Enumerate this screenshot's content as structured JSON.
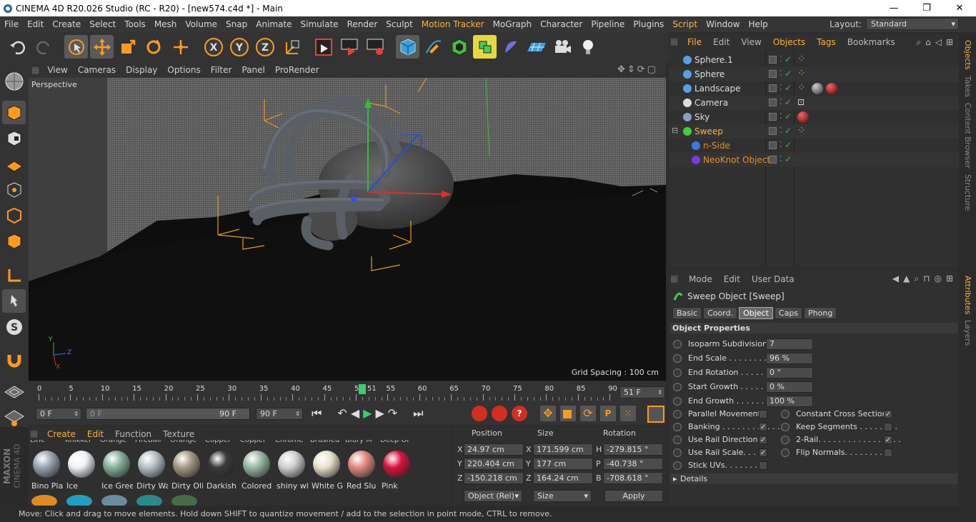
{
  "window": {
    "title": "CINEMA 4D R20.026 Studio (RC - R20) - [new574.c4d *] - Main"
  },
  "menu": [
    "File",
    "Edit",
    "Create",
    "Select",
    "Tools",
    "Mesh",
    "Volume",
    "Snap",
    "Animate",
    "Simulate",
    "Render",
    "Sculpt",
    "Motion Tracker",
    "MoGraph",
    "Character",
    "Pipeline",
    "Plugins",
    "Script",
    "Window",
    "Help"
  ],
  "layout": {
    "label": "Layout:",
    "value": "Standard"
  },
  "viewport": {
    "menu": [
      "View",
      "Cameras",
      "Display",
      "Options",
      "Filter",
      "Panel",
      "ProRender"
    ],
    "camera_label": "Perspective",
    "grid_spacing": "Grid Spacing : 100 cm",
    "axes": {
      "y": "Y",
      "z": "Z",
      "x": "X"
    }
  },
  "timeline": {
    "ticks": [
      "0",
      "5",
      "10",
      "15",
      "20",
      "25",
      "30",
      "35",
      "40",
      "45",
      "50",
      "55",
      "60",
      "65",
      "70",
      "75",
      "80",
      "85",
      "90"
    ],
    "current_marker": "51",
    "current_frame": "51 F"
  },
  "transport": {
    "start": "0 F",
    "range_start": "0 F",
    "range_end": "90 F",
    "end": "90 F"
  },
  "materials": {
    "menu": [
      "Create",
      "Edit",
      "Function",
      "Texture"
    ],
    "top_row_clipped": [
      "Line",
      "Knikker",
      "Orange",
      "FireBall",
      "Orange",
      "Copper",
      "Copper",
      "Chrome",
      "Brushed",
      "Blury M",
      "Deep Or"
    ],
    "items": [
      {
        "name": "Bino Pla",
        "color": "#9aa4b4"
      },
      {
        "name": "Ice",
        "color": "#eef3f6"
      },
      {
        "name": "Ice Gree",
        "color": "#86b09a"
      },
      {
        "name": "Dirty Wa",
        "color": "#b6c0c6"
      },
      {
        "name": "Dirty Oli",
        "color": "#a59a84"
      },
      {
        "name": "Darkish",
        "color": "#3a3a3a"
      },
      {
        "name": "Colored",
        "color": "#9ab6a4"
      },
      {
        "name": "shiny wl",
        "color": "#cfcfcf"
      },
      {
        "name": "White G",
        "color": "#e9e2cc"
      },
      {
        "name": "Red Slu",
        "color": "#e08a82"
      },
      {
        "name": "Pink",
        "color": "#d8143c"
      }
    ]
  },
  "coordinates": {
    "headers": {
      "position": "Position",
      "size": "Size",
      "rotation": "Rotation"
    },
    "rows": [
      {
        "axis": "X",
        "pos": "24.97 cm",
        "size_axis": "X",
        "size": "171.599 cm",
        "rot_axis": "H",
        "rot": "-279.815 °"
      },
      {
        "axis": "Y",
        "pos": "220.404 cm",
        "size_axis": "Y",
        "size": "177 cm",
        "rot_axis": "P",
        "rot": "-40.738 °"
      },
      {
        "axis": "Z",
        "pos": "-150.218 cm",
        "size_axis": "Z",
        "size": "164.24 cm",
        "rot_axis": "B",
        "rot": "-708.618 °"
      }
    ],
    "mode": "Object (Rel)",
    "size_mode": "Size",
    "apply": "Apply"
  },
  "status": "Move: Click and drag to move elements. Hold down SHIFT to quantize movement / add to the selection in point mode, CTRL to remove.",
  "object_manager": {
    "menu": [
      "File",
      "Edit",
      "View",
      "Objects",
      "Tags",
      "Bookmarks"
    ],
    "objects": [
      {
        "name": "Sphere.1",
        "indent": 0,
        "selected": false
      },
      {
        "name": "Sphere",
        "indent": 0,
        "selected": false
      },
      {
        "name": "Landscape",
        "indent": 0,
        "selected": false
      },
      {
        "name": "Camera",
        "indent": 0,
        "selected": false
      },
      {
        "name": "Sky",
        "indent": 0,
        "selected": false
      },
      {
        "name": "Sweep",
        "indent": 0,
        "selected": true
      },
      {
        "name": "n-Side",
        "indent": 1,
        "selected": false
      },
      {
        "name": "NeoKnot Object",
        "indent": 1,
        "selected": false
      }
    ]
  },
  "side_tabs": [
    "Objects",
    "Takes",
    "Content Browser",
    "Structure"
  ],
  "side_tabs_bottom": [
    "Attributes",
    "Layers"
  ],
  "attributes": {
    "menu": [
      "Mode",
      "Edit",
      "User Data"
    ],
    "object_title": "Sweep Object [Sweep]",
    "tabs": [
      "Basic",
      "Coord.",
      "Object",
      "Caps",
      "Phong"
    ],
    "active_tab": "Object",
    "section": "Object Properties",
    "fields": [
      {
        "label": "Isoparm Subdivision",
        "value": "7"
      },
      {
        "label": "End Scale . . . . . . . . . .",
        "value": "96 %"
      },
      {
        "label": "End Rotation . . . . . .",
        "value": "0 °"
      },
      {
        "label": "Start Growth . . . . . .",
        "value": "0 %"
      },
      {
        "label": "End Growth . . . . . . .",
        "value": "100 %"
      }
    ],
    "checks_left": [
      {
        "label": "Parallel Movement",
        "checked": false
      },
      {
        "label": "Banking . . . . . . . . . . . .",
        "checked": true
      },
      {
        "label": "Use Rail Direction",
        "checked": true
      },
      {
        "label": "Use Rail Scale. . . . .",
        "checked": true
      },
      {
        "label": "Stick UVs. . . . . . . . .",
        "checked": false
      }
    ],
    "checks_right": [
      {
        "label": "Constant Cross Section",
        "checked": true
      },
      {
        "label": "Keep Segments . . . . . . . .",
        "checked": false
      },
      {
        "label": "2-Rail. . . . . . . . . . . . . . . . .",
        "checked": true
      },
      {
        "label": "Flip Normals. . . . . . . . . .",
        "checked": false
      }
    ],
    "details": "Details"
  },
  "branding": {
    "maxon": "MAXON",
    "cinema": "CINEMA 4D"
  }
}
